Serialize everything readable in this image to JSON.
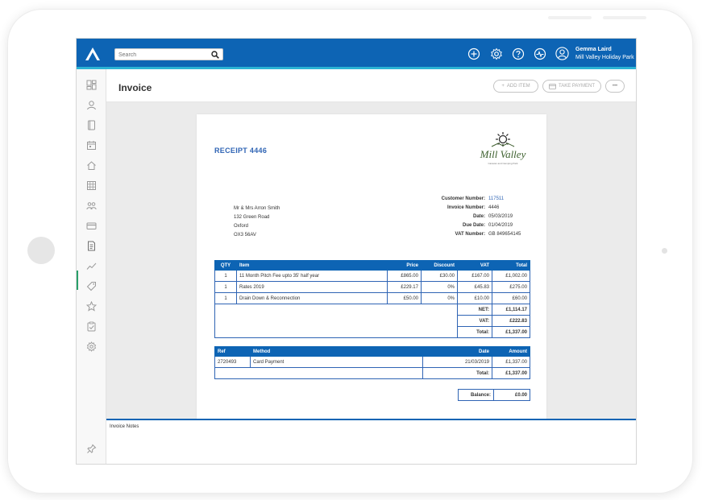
{
  "search": {
    "placeholder": "Search"
  },
  "user": {
    "name": "Gemma Laird",
    "org": "Mill Valley Holiday Park"
  },
  "page": {
    "title": "Invoice"
  },
  "actions": {
    "add_item": "ADD ITEM",
    "take_payment": "TAKE PAYMENT",
    "more": "•••"
  },
  "invoice": {
    "receipt_title": "RECEIPT 4446",
    "brand": {
      "name": "Mill Valley",
      "tagline": "Caravan and Camping Park"
    },
    "address": [
      "Mr & Mrs Arron Smith",
      "132 Green Road",
      "Oxford",
      "OX3 56AV"
    ],
    "meta": [
      {
        "label": "Customer Number:",
        "value": "117511"
      },
      {
        "label": "Invoice Number:",
        "value": "4446"
      },
      {
        "label": "Date:",
        "value": "05/03/2019"
      },
      {
        "label": "Due Date:",
        "value": "01/04/2019"
      },
      {
        "label": "VAT Number:",
        "value": "GB 849654145"
      }
    ],
    "items_headers": {
      "qty": "QTY",
      "item": "Item",
      "price": "Price",
      "discount": "Discount",
      "vat": "VAT",
      "total": "Total"
    },
    "items": [
      {
        "qty": "1",
        "item": "11 Month Pitch Fee upto 35' half year",
        "price": "£865.00",
        "discount": "£30.00",
        "vat": "£167.00",
        "total": "£1,002.00"
      },
      {
        "qty": "1",
        "item": "Rates 2019",
        "price": "£229.17",
        "discount": "0%",
        "vat": "£45.83",
        "total": "£275.00"
      },
      {
        "qty": "1",
        "item": "Drain Down & Reconnection",
        "price": "£50.00",
        "discount": "0%",
        "vat": "£10.00",
        "total": "£60.00"
      }
    ],
    "summary": {
      "net_label": "NET:",
      "net": "£1,114.17",
      "vat_label": "VAT:",
      "vat": "£222.83",
      "total_label": "Total:",
      "total": "£1,337.00"
    },
    "payments_headers": {
      "ref": "Ref",
      "method": "Method",
      "date": "Date",
      "amount": "Amount"
    },
    "payments": [
      {
        "ref": "2720493",
        "method": "Card Payment",
        "date": "21/03/2019",
        "amount": "£1,337.00"
      }
    ],
    "payments_total": {
      "label": "Total:",
      "value": "£1,337.00"
    },
    "balance": {
      "label": "Balance:",
      "value": "£0.00"
    }
  },
  "notes": {
    "label": "Invoice Notes"
  },
  "colors": {
    "brand_blue": "#0d64b4",
    "accent_cyan": "#2bb3d4",
    "link_blue": "#2f64b4",
    "active_green": "#29a06a"
  },
  "icons": {
    "topbar": [
      "add-icon",
      "settings-icon",
      "help-icon",
      "activity-icon",
      "user-avatar-icon"
    ],
    "sidebar": [
      "dashboard-icon",
      "contacts-icon",
      "bookings-icon",
      "calendar-icon",
      "home-icon",
      "planner-icon",
      "groups-icon",
      "payments-icon",
      "invoices-icon",
      "reports-icon",
      "tags-icon",
      "favourites-icon",
      "tasks-icon",
      "settings-icon",
      "pin-icon"
    ]
  }
}
